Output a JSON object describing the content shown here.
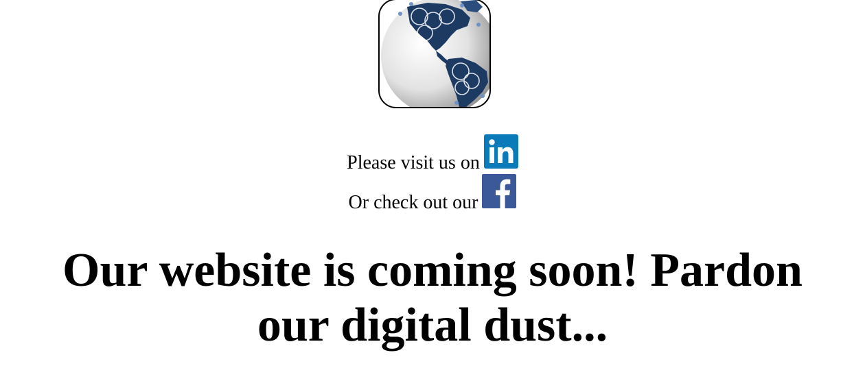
{
  "logo": {
    "icon": "globe-icon"
  },
  "social": {
    "linkedin_text": "Please visit us on",
    "linkedin_icon": "linkedin-icon",
    "linkedin_color": "#0a7ab8",
    "facebook_text": "Or check out our",
    "facebook_icon": "facebook-icon",
    "facebook_color": "#3b5998"
  },
  "headline": {
    "line1": "Our website is coming soon! Pardon",
    "line2": "our digital dust..."
  }
}
